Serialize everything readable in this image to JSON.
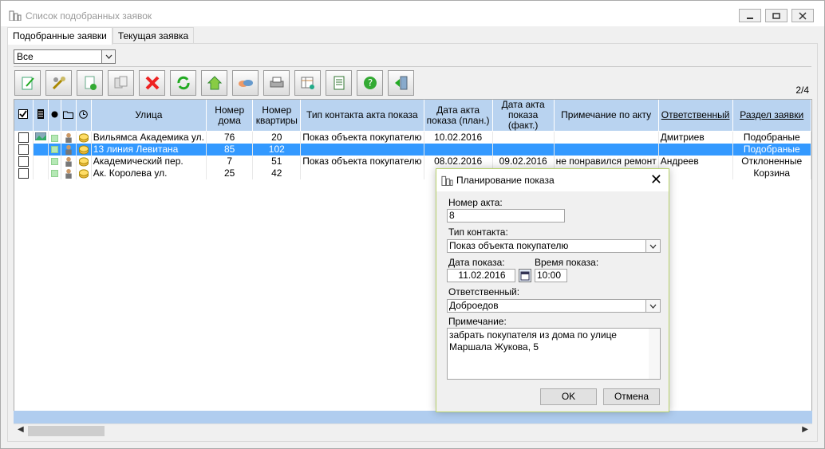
{
  "window": {
    "title": "Список подобранных заявок"
  },
  "tabs": [
    {
      "label": "Подобранные заявки",
      "active": true
    },
    {
      "label": "Текущая заявка",
      "active": false
    }
  ],
  "filter": {
    "value": "Все"
  },
  "pager": "2/4",
  "toolbar_icons": [
    "edit-icon",
    "tools-icon",
    "document-check-icon",
    "copy-icon",
    "delete-icon",
    "refresh-icon",
    "home-icon",
    "handshake-icon",
    "print-icon",
    "table-icon",
    "report-icon",
    "help-icon",
    "exit-icon"
  ],
  "grid": {
    "headers": {
      "street": "Улица",
      "house": "Номер дома",
      "apartment": "Номер квартиры",
      "contact_type": "Тип контакта акта показа",
      "date_plan": "Дата акта показа (план.)",
      "date_fact": "Дата акта показа (факт.)",
      "note": "Примечание по акту",
      "responsible": "Ответственный",
      "section": "Раздел заявки"
    },
    "rows": [
      {
        "street": "Вильямса Академика ул.",
        "house": "76",
        "apartment": "20",
        "contact_type": "Показ объекта покупателю",
        "date_plan": "10.02.2016",
        "date_fact": "",
        "note": "",
        "responsible": "Дмитриев",
        "section": "Подобраные"
      },
      {
        "street": "13 линия Левитана",
        "house": "85",
        "apartment": "102",
        "contact_type": "",
        "date_plan": "",
        "date_fact": "",
        "note": "",
        "responsible": "",
        "section": "Подобраные"
      },
      {
        "street": "Академический пер.",
        "house": "7",
        "apartment": "51",
        "contact_type": "Показ объекта покупателю",
        "date_plan": "08.02.2016",
        "date_fact": "09.02.2016",
        "note": "не понравился ремонт",
        "responsible": "Андреев",
        "section": "Отклоненные"
      },
      {
        "street": "Ак. Королева ул.",
        "house": "25",
        "apartment": "42",
        "contact_type": "",
        "date_plan": "",
        "date_fact": "",
        "note": "",
        "responsible": "",
        "section": "Корзина"
      }
    ]
  },
  "dialog": {
    "title": "Планирование показа",
    "act_number_label": "Номер акта:",
    "act_number": "8",
    "contact_type_label": "Тип контакта:",
    "contact_type": "Показ объекта покупателю",
    "date_label": "Дата показа:",
    "date": "11.02.2016",
    "time_label": "Время показа:",
    "time": "10:00",
    "responsible_label": "Ответственный:",
    "responsible": "Доброедов",
    "note_label": "Примечание:",
    "note": "забрать покупателя из дома по улице Маршала Жукова, 5",
    "ok": "OK",
    "cancel": "Отмена"
  },
  "colors": {
    "header_bg": "#b9d3f0",
    "selection": "#3399ff",
    "dialog_border": "#b7d26a"
  }
}
